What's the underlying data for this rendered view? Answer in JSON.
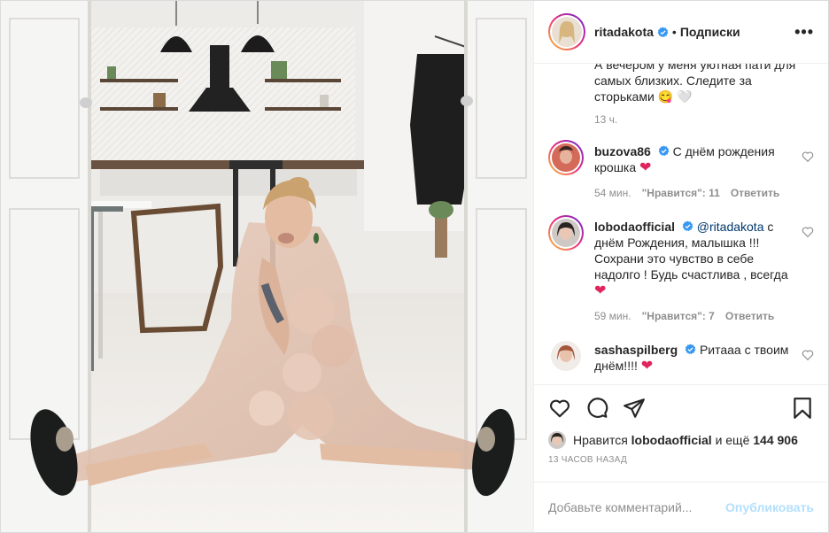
{
  "post": {
    "author": "ritadakota",
    "follow_status": "Подписки",
    "separator": "•",
    "more": "•••",
    "caption_text": "А вечером у меня уютная пати для самых близких. Следите за сторьками 😋",
    "caption_tail": "🤍",
    "caption_time": "13 ч."
  },
  "comments": [
    {
      "user": "buzova86",
      "text": "С днём рождения крошка",
      "emoji": "❤",
      "time": "54 мин.",
      "likes": "\"Нравится\": 11",
      "reply": "Ответить",
      "avatar_ring": true
    },
    {
      "user": "lobodaofficial",
      "mention": "@ritadakota",
      "text": "с днём Рождения, малышка !!! Сохрани это чувство в себе надолго ! Будь счастлива , всегда",
      "emoji": "❤",
      "time": "59 мин.",
      "likes": "\"Нравится\": 7",
      "reply": "Ответить",
      "avatar_ring": true
    },
    {
      "user": "sashaspilberg",
      "text": "Ритааа с твоим днём!!!!",
      "emoji": "❤",
      "avatar_ring": false
    }
  ],
  "likes": {
    "prefix": "Нравится",
    "user": "lobodaofficial",
    "joiner": "и ещё",
    "count": "144 906"
  },
  "timestamp": "13 ЧАСОВ НАЗАД",
  "add_comment": {
    "placeholder": "Добавьте комментарий...",
    "publish": "Опубликовать"
  },
  "icons": {
    "like": "heart-outline-icon",
    "comment": "comment-bubble-icon",
    "share": "paper-plane-icon",
    "save": "bookmark-icon",
    "verified": "verified-badge-icon",
    "more": "more-dots-icon"
  },
  "colors": {
    "text": "#262626",
    "muted": "#8e8e8e",
    "verified": "#3897f0",
    "publish_disabled": "#b2dffc",
    "mention": "#00376b",
    "heart": "#e0245e"
  }
}
